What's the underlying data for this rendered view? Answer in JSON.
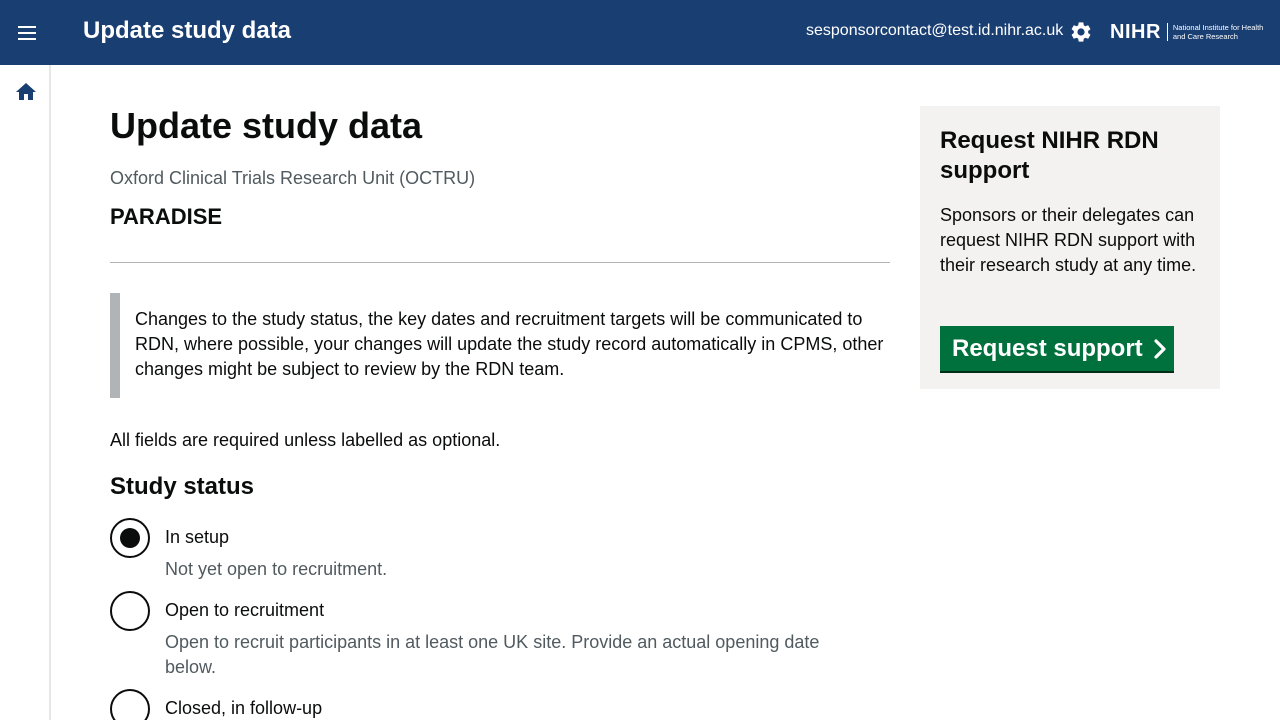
{
  "header": {
    "title": "Update study data",
    "user_email": "sesponsorcontact@test.id.nihr.ac.uk",
    "logo_mark": "NIHR",
    "logo_subtitle": "National Institute for Health and Care Research"
  },
  "main": {
    "page_title": "Update study data",
    "organisation": "Oxford Clinical Trials Research Unit (OCTRU)",
    "study_name": "PARADISE",
    "inset_text": "Changes to the study status, the key dates and recruitment targets will be communicated to RDN, where possible, your changes will update the study record automatically in CPMS, other changes might be subject to review by the RDN team.",
    "required_note": "All fields are required unless labelled as optional.",
    "study_status": {
      "heading": "Study status",
      "selected": "In setup",
      "options": [
        {
          "label": "In setup",
          "hint": "Not yet open to recruitment."
        },
        {
          "label": "Open to recruitment",
          "hint": "Open to recruit participants in at least one UK site. Provide an actual opening date below."
        },
        {
          "label": "Closed, in follow-up",
          "hint": ""
        }
      ]
    }
  },
  "aside": {
    "title": "Request NIHR RDN support",
    "text": "Sponsors or their delegates can request NIHR RDN support with their research study at any time.",
    "button_label": "Request support"
  },
  "icons": {
    "menu": "menu-icon",
    "settings": "gear-icon",
    "home": "home-icon",
    "button_arrow": "chevron-right-icon"
  },
  "colors": {
    "header_bg": "#193e72",
    "button_green": "#00703c",
    "aside_bg": "#f3f2f1",
    "inset_border": "#b1b4b6"
  }
}
